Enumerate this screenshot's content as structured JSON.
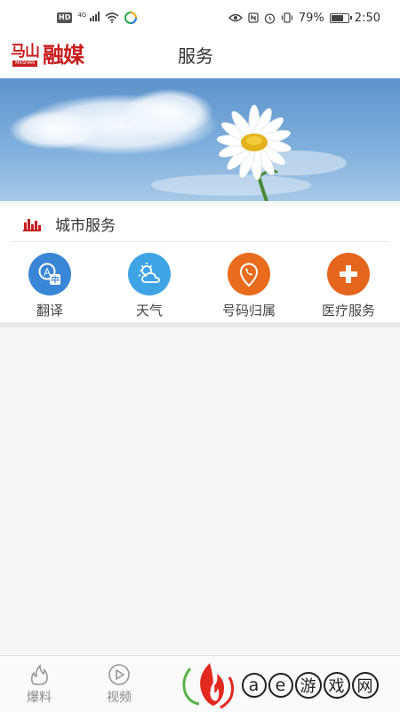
{
  "status_bar": {
    "hd": "HD",
    "network": "4G",
    "battery": "79%",
    "battery_level": 0.79,
    "time": "2:50"
  },
  "header": {
    "logo_small": "马山",
    "logo_sub": "MASHAN",
    "logo_big": "融媒",
    "title": "服务"
  },
  "section": {
    "title": "城市服务",
    "icon": "city-skyline-icon"
  },
  "services": [
    {
      "label": "翻译",
      "icon": "translate-icon",
      "color": "#3a86d6"
    },
    {
      "label": "天气",
      "icon": "weather-icon",
      "color": "#3fa4e6"
    },
    {
      "label": "号码归属",
      "icon": "phone-location-icon",
      "color": "#e96b1e"
    },
    {
      "label": "医疗服务",
      "icon": "medical-plus-icon",
      "color": "#e5651c"
    }
  ],
  "bottom_nav": [
    {
      "label": "爆料",
      "icon": "flame-icon"
    },
    {
      "label": "视频",
      "icon": "play-icon"
    }
  ],
  "watermark": {
    "a": "a",
    "e": "e",
    "chars": [
      "游",
      "戏",
      "网"
    ]
  },
  "colors": {
    "brand_red": "#c81e1e",
    "accent_blue": "#3a86d6",
    "accent_orange": "#e5651c"
  }
}
